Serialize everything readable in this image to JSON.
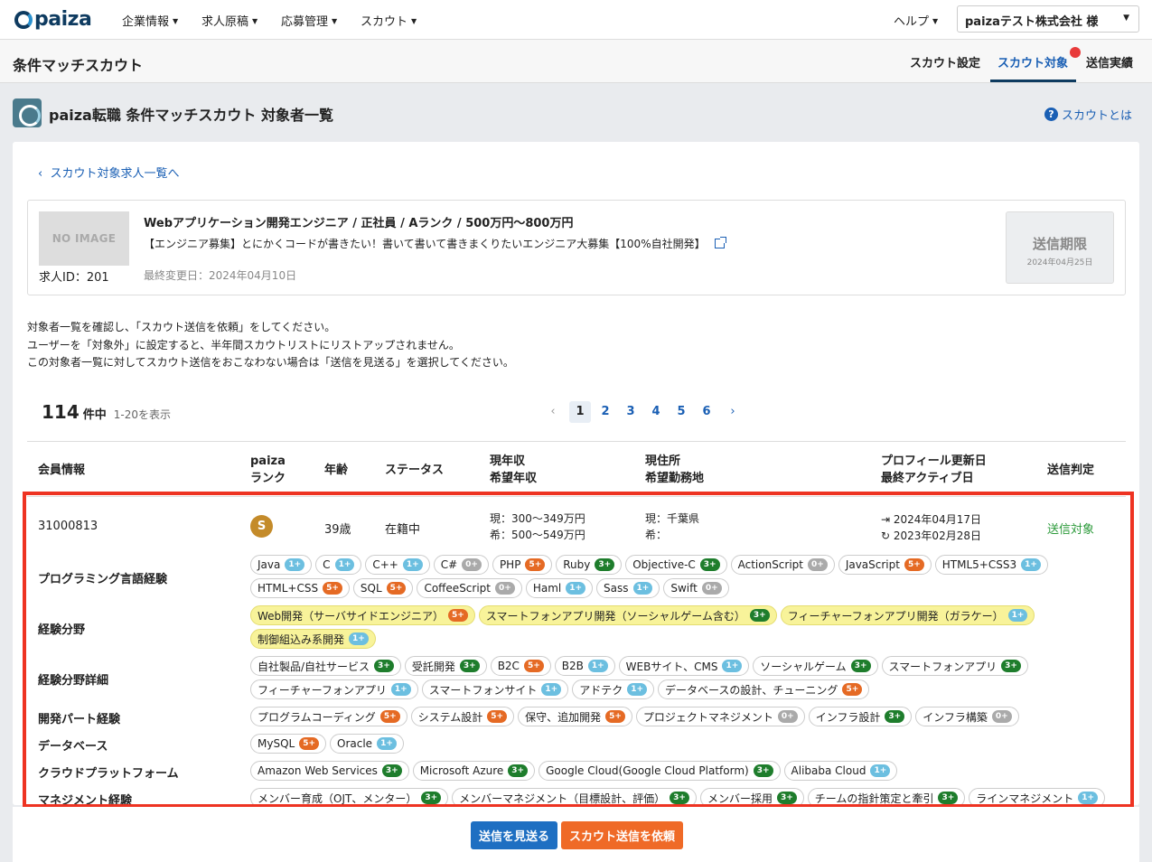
{
  "nav": {
    "logo": "paiza",
    "menus": [
      "企業情報",
      "求人原稿",
      "応募管理",
      "スカウト"
    ],
    "help": "ヘルプ",
    "company": "paizaテスト株式会社 様"
  },
  "subheader": {
    "title": "条件マッチスカウト",
    "tabs": [
      "スカウト設定",
      "スカウト対象",
      "送信実績"
    ],
    "active_tab": "スカウト対象"
  },
  "page": {
    "title": "paiza転職 条件マッチスカウト 対象者一覧",
    "help_link": "スカウトとは",
    "back_link": "スカウト対象求人一覧へ"
  },
  "job": {
    "no_image": "NO IMAGE",
    "id_label": "求人ID：201",
    "title": "Webアプリケーション開発エンジニア / 正社員 / Aランク / 500万円〜800万円",
    "subtitle": "【エンジニア募集】とにかくコードが書きたい！書いて書いて書きまくりたいエンジニア大募集【100%自社開発】",
    "updated": "最終変更日：2024年04月10日",
    "deadline_label": "送信期限",
    "deadline_date": "2024年04月25日"
  },
  "instructions": [
    "対象者一覧を確認し、「スカウト送信を依頼」をしてください。",
    "ユーザーを「対象外」に設定すると、半年間スカウトリストにリストアップされません。",
    "この対象者一覧に対してスカウト送信をおこなわない場合は「送信を見送る」を選択してください。"
  ],
  "results": {
    "total": "114",
    "unit": "件中",
    "range": "1-20を表示"
  },
  "pagination": {
    "prev": "‹",
    "pages": [
      "1",
      "2",
      "3",
      "4",
      "5",
      "6"
    ],
    "current": "1",
    "next": "›"
  },
  "table": {
    "headers": {
      "member": "会員情報",
      "rank1": "paiza",
      "rank2": "ランク",
      "age": "年齢",
      "status": "ステータス",
      "income1": "現年収",
      "income2": "希望年収",
      "location1": "現住所",
      "location2": "希望勤務地",
      "profile1": "プロフィール更新日",
      "profile2": "最終アクティブ日",
      "judge": "送信判定"
    },
    "row": {
      "member_id": "31000813",
      "rank": "S",
      "age": "39歳",
      "status": "在籍中",
      "income_current": "現：300〜349万円",
      "income_desired": "希：500〜549万円",
      "location_current": "現：千葉県",
      "location_desired": "希：",
      "profile_updated": "2024年04月17日",
      "last_active": "2023年02月28日",
      "judge": "送信対象"
    }
  },
  "skills": [
    {
      "label": "プログラミング言語経験",
      "tags": [
        {
          "name": "Java",
          "level": "1+"
        },
        {
          "name": "C",
          "level": "1+"
        },
        {
          "name": "C++",
          "level": "1+"
        },
        {
          "name": "C#",
          "level": "0+"
        },
        {
          "name": "PHP",
          "level": "5+"
        },
        {
          "name": "Ruby",
          "level": "3+"
        },
        {
          "name": "Objective-C",
          "level": "3+"
        },
        {
          "name": "ActionScript",
          "level": "0+"
        },
        {
          "name": "JavaScript",
          "level": "5+"
        },
        {
          "name": "HTML5+CSS3",
          "level": "1+"
        },
        {
          "name": "HTML+CSS",
          "level": "5+"
        },
        {
          "name": "SQL",
          "level": "5+"
        },
        {
          "name": "CoffeeScript",
          "level": "0+"
        },
        {
          "name": "Haml",
          "level": "1+"
        },
        {
          "name": "Sass",
          "level": "1+"
        },
        {
          "name": "Swift",
          "level": "0+"
        }
      ]
    },
    {
      "label": "経験分野",
      "tags": [
        {
          "name": "Web開発（サーバサイドエンジニア）",
          "level": "5+",
          "hl": true
        },
        {
          "name": "スマートフォンアプリ開発（ソーシャルゲーム含む）",
          "level": "3+",
          "hl": true
        },
        {
          "name": "フィーチャーフォンアプリ開発（ガラケー）",
          "level": "1+",
          "hl": true
        },
        {
          "name": "制御組込み系開発",
          "level": "1+",
          "hl": true
        }
      ]
    },
    {
      "label": "経験分野詳細",
      "tags": [
        {
          "name": "自社製品/自社サービス",
          "level": "3+"
        },
        {
          "name": "受託開発",
          "level": "3+"
        },
        {
          "name": "B2C",
          "level": "5+"
        },
        {
          "name": "B2B",
          "level": "1+"
        },
        {
          "name": "WEBサイト、CMS",
          "level": "1+"
        },
        {
          "name": "ソーシャルゲーム",
          "level": "3+"
        },
        {
          "name": "スマートフォンアプリ",
          "level": "3+"
        },
        {
          "name": "フィーチャーフォンアプリ",
          "level": "1+"
        },
        {
          "name": "スマートフォンサイト",
          "level": "1+"
        },
        {
          "name": "アドテク",
          "level": "1+"
        },
        {
          "name": "データベースの設計、チューニング",
          "level": "5+"
        }
      ]
    },
    {
      "label": "開発パート経験",
      "tags": [
        {
          "name": "プログラムコーディング",
          "level": "5+"
        },
        {
          "name": "システム設計",
          "level": "5+"
        },
        {
          "name": "保守、追加開発",
          "level": "5+"
        },
        {
          "name": "プロジェクトマネジメント",
          "level": "0+"
        },
        {
          "name": "インフラ設計",
          "level": "3+"
        },
        {
          "name": "インフラ構築",
          "level": "0+"
        }
      ]
    },
    {
      "label": "データベース",
      "tags": [
        {
          "name": "MySQL",
          "level": "5+"
        },
        {
          "name": "Oracle",
          "level": "1+"
        }
      ]
    },
    {
      "label": "クラウドプラットフォーム",
      "tags": [
        {
          "name": "Amazon Web Services",
          "level": "3+"
        },
        {
          "name": "Microsoft Azure",
          "level": "3+"
        },
        {
          "name": "Google Cloud(Google Cloud Platform)",
          "level": "3+"
        },
        {
          "name": "Alibaba Cloud",
          "level": "1+"
        }
      ]
    },
    {
      "label": "マネジメント経験",
      "tags": [
        {
          "name": "メンバー育成（OJT、メンター）",
          "level": "3+"
        },
        {
          "name": "メンバーマネジメント（目標設計、評価）",
          "level": "3+"
        },
        {
          "name": "メンバー採用",
          "level": "3+"
        },
        {
          "name": "チームの指針策定と牽引",
          "level": "3+"
        },
        {
          "name": "ラインマネジメント",
          "level": "1+"
        }
      ]
    }
  ],
  "actions": {
    "skip": "送信を見送る",
    "request": "スカウト送信を依頼"
  },
  "colors": {
    "primary_blue": "#1e6fc2",
    "orange": "#ef6a27",
    "highlight_box": "#ee3322",
    "status_green": "#2b9a3a"
  }
}
